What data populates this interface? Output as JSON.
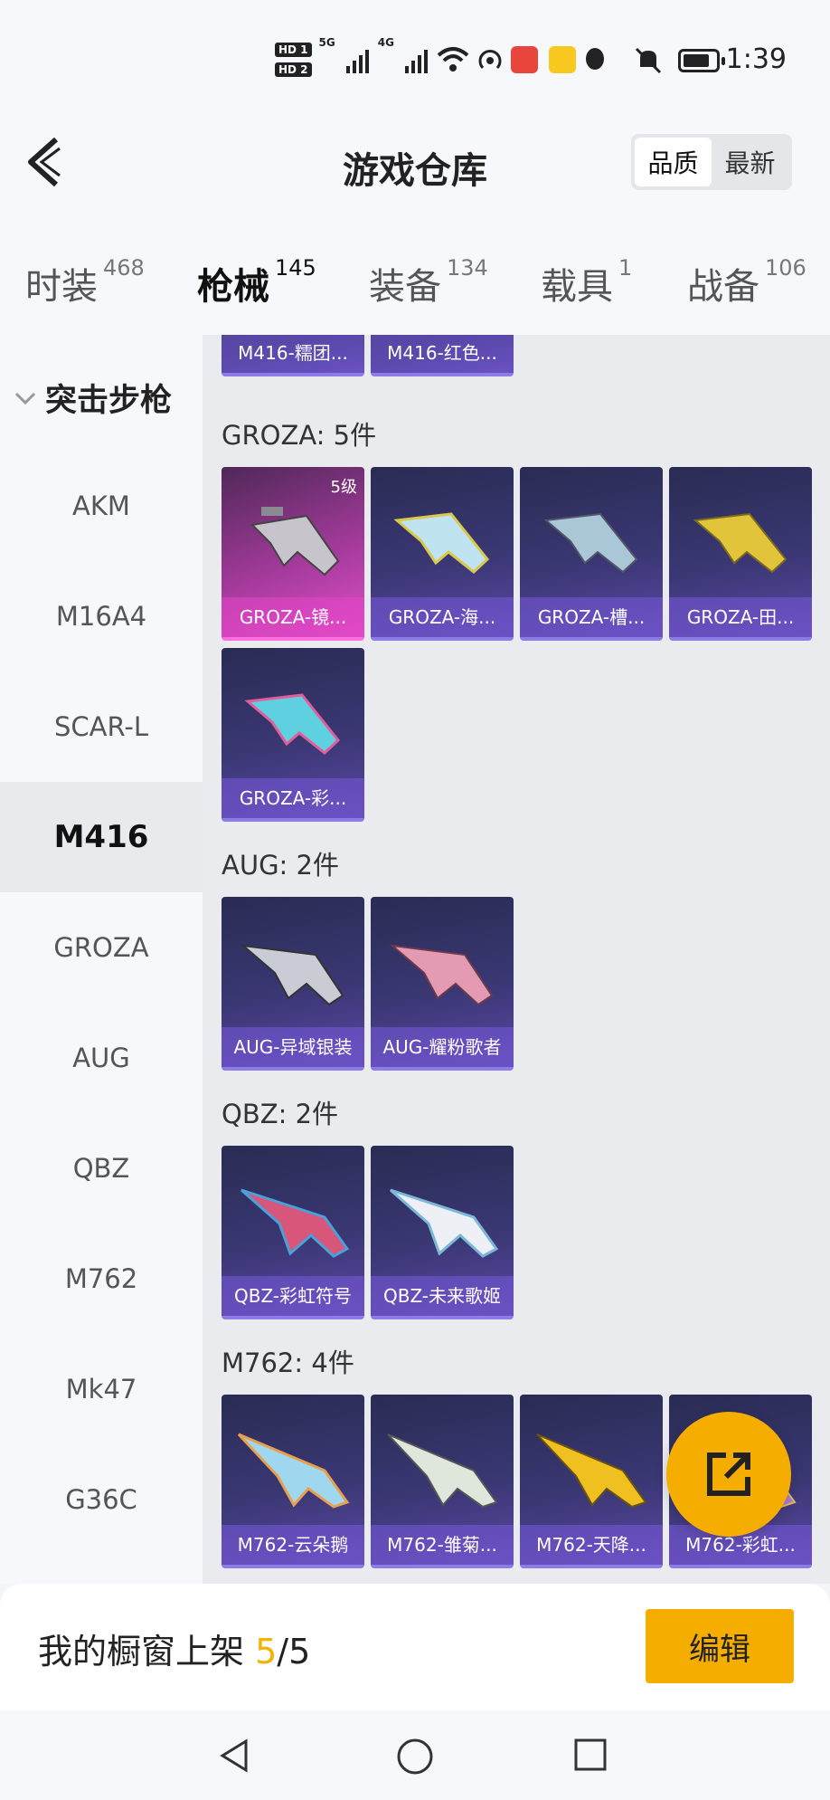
{
  "status": {
    "time": "1:39",
    "hd1": "HD 1",
    "hd2": "HD 2",
    "net1": "5G",
    "net2": "4G"
  },
  "header": {
    "title": "游戏仓库",
    "sort_quality": "品质",
    "sort_latest": "最新"
  },
  "tabs": [
    {
      "label": "时装",
      "count": "468"
    },
    {
      "label": "枪械",
      "count": "145"
    },
    {
      "label": "装备",
      "count": "134"
    },
    {
      "label": "载具",
      "count": "1"
    },
    {
      "label": "战备",
      "count": "106"
    }
  ],
  "sidebar": {
    "category": "突击步枪",
    "items": [
      "AKM",
      "M16A4",
      "SCAR-L",
      "M416",
      "GROZA",
      "AUG",
      "QBZ",
      "M762",
      "Mk47",
      "G36C"
    ],
    "selected": "M416"
  },
  "sections": {
    "top_cards": [
      "M416-糯团...",
      "M416-红色..."
    ],
    "groza": {
      "title": "GROZA: 5件",
      "cards": [
        "GROZA-镜...",
        "GROZA-海...",
        "GROZA-槽...",
        "GROZA-田...",
        "GROZA-彩..."
      ],
      "level_badge": "5级"
    },
    "aug": {
      "title": "AUG: 2件",
      "cards": [
        "AUG-异域银装",
        "AUG-耀粉歌者"
      ]
    },
    "qbz": {
      "title": "QBZ: 2件",
      "cards": [
        "QBZ-彩虹符号",
        "QBZ-未来歌姬"
      ]
    },
    "m762": {
      "title": "M762: 4件",
      "cards": [
        "M762-云朵鹅",
        "M762-雏菊...",
        "M762-天降...",
        "M762-彩虹..."
      ]
    }
  },
  "bottom": {
    "label": "我的橱窗上架 ",
    "current": "5",
    "total": "/5",
    "edit": "编辑"
  },
  "colors": {
    "accent": "#f5ad00",
    "card_purple": "#3a3773",
    "card_pink": "#c23fb0"
  }
}
